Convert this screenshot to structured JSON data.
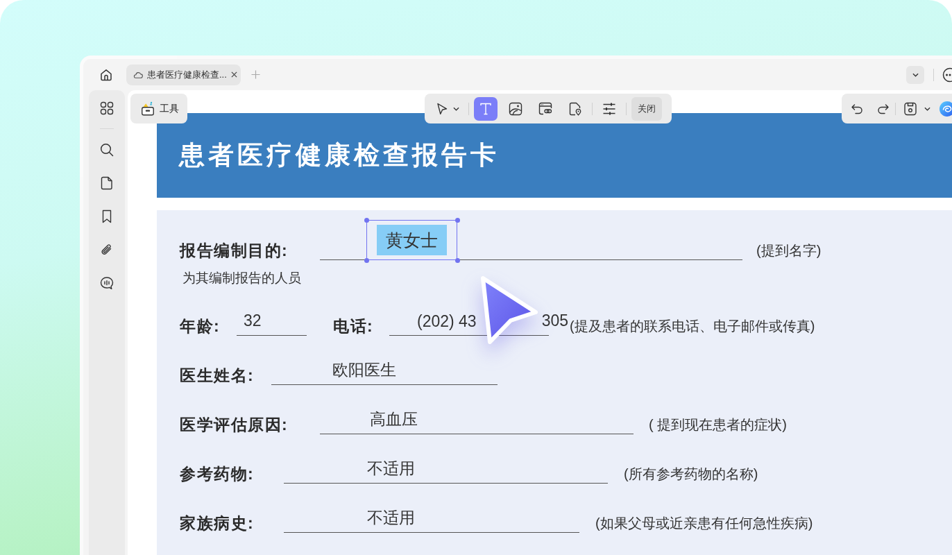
{
  "tabs": [
    {
      "title": "患者医疗健康检查...",
      "selected": true
    }
  ],
  "toolbar": {
    "tools_button": "工具",
    "tools": [
      {
        "kind": "select",
        "selected": false
      },
      {
        "kind": "text",
        "selected": true
      },
      {
        "kind": "image",
        "selected": false
      },
      {
        "kind": "link",
        "selected": false
      },
      {
        "kind": "pin",
        "selected": false
      },
      {
        "kind": "adjust",
        "selected": false
      }
    ],
    "close_button": "关闭"
  },
  "document": {
    "title": "患者医疗健康检查报告卡",
    "rows": [
      {
        "fields": [
          {
            "label": "报告编制目的:",
            "value": "黄女士",
            "selected": true
          }
        ],
        "hint": "(提到名字)",
        "note": "为其编制报告的人员"
      },
      {
        "fields": [
          {
            "label": "年龄:",
            "value": "32",
            "selected": false
          },
          {
            "label": "电话:",
            "value": "(202) 43",
            "value_end": "305",
            "selected": false
          }
        ],
        "hint": "(提及患者的联系电话、电子邮件或传真)"
      },
      {
        "fields": [
          {
            "label": "医生姓名:",
            "value": "欧阳医生",
            "selected": false
          }
        ]
      },
      {
        "fields": [
          {
            "label": "医学评估原因:",
            "value": "高血压",
            "selected": false
          }
        ],
        "hint": "( 提到现在患者的症状)"
      },
      {
        "fields": [
          {
            "label": "参考药物:",
            "value": "不适用",
            "selected": false
          }
        ],
        "hint": "(所有参考药物的名称)"
      },
      {
        "fields": [
          {
            "label": "家族病史:",
            "value": "不适用",
            "selected": false
          }
        ],
        "hint": "(如果父母或近亲患有任何急性疾病)"
      }
    ]
  }
}
